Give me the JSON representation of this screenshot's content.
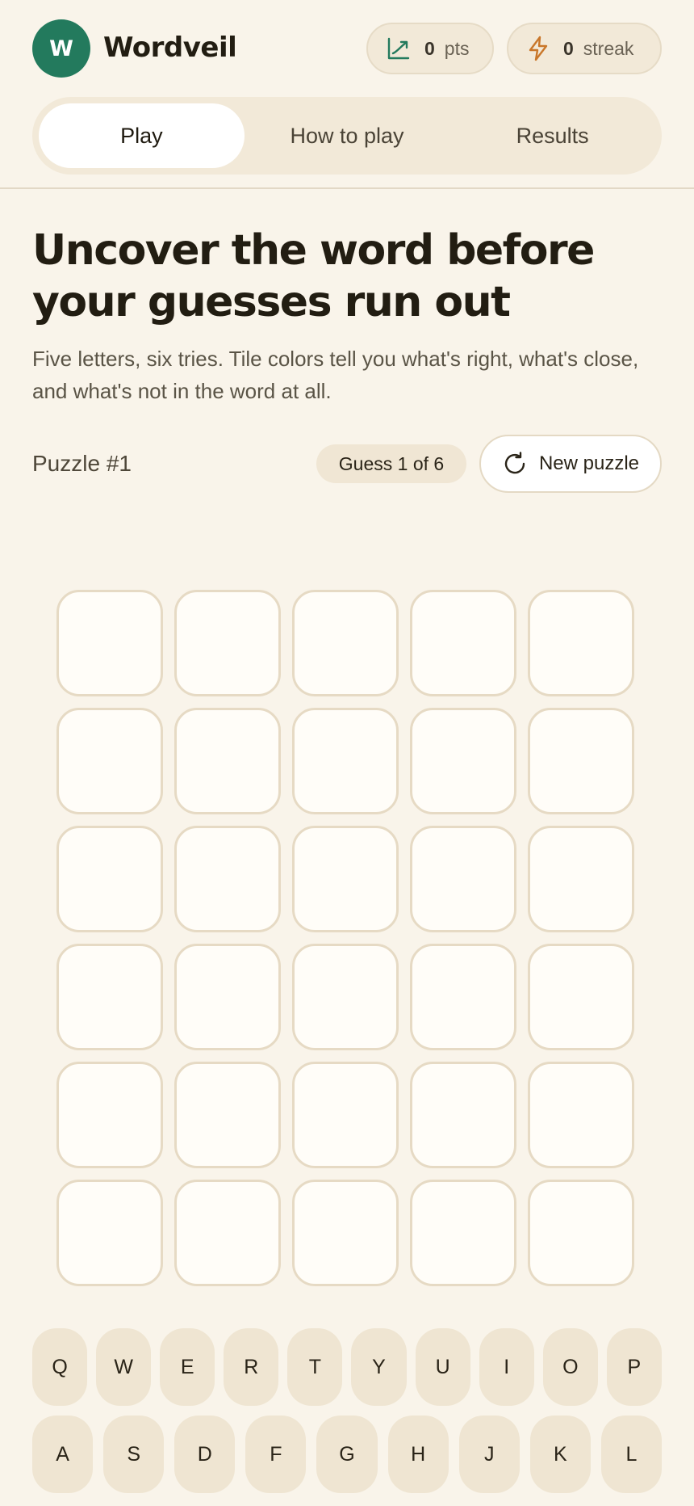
{
  "app": {
    "logo_letter": "W",
    "brand": "Wordveil"
  },
  "stats": {
    "points_value": "0",
    "points_label": "pts",
    "streak_value": "0",
    "streak_label": "streak"
  },
  "tabs": [
    {
      "label": "Play",
      "active": true
    },
    {
      "label": "How to play",
      "active": false
    },
    {
      "label": "Results",
      "active": false
    }
  ],
  "hero": {
    "title": "Uncover the word before your guesses run out",
    "subtitle": "Five letters, six tries. Tile colors tell you what's right, what's close, and what's not in the word at all."
  },
  "puzzle": {
    "label": "Puzzle #1",
    "guess_status": "Guess 1 of 6",
    "new_puzzle_label": "New puzzle"
  },
  "board": {
    "rows": 6,
    "cols": 5,
    "letters": [
      [
        "",
        "",
        "",
        "",
        ""
      ],
      [
        "",
        "",
        "",
        "",
        ""
      ],
      [
        "",
        "",
        "",
        "",
        ""
      ],
      [
        "",
        "",
        "",
        "",
        ""
      ],
      [
        "",
        "",
        "",
        "",
        ""
      ],
      [
        "",
        "",
        "",
        "",
        ""
      ]
    ]
  },
  "keyboard": {
    "row1": [
      "Q",
      "W",
      "E",
      "R",
      "T",
      "Y",
      "U",
      "I",
      "O",
      "P"
    ],
    "row2": [
      "A",
      "S",
      "D",
      "F",
      "G",
      "H",
      "J",
      "K",
      "L"
    ]
  },
  "colors": {
    "background": "#f9f4ea",
    "accent": "#237a5d",
    "streak_icon": "#c9772a",
    "tile_border": "#e6dac4",
    "key_bg": "#efe5d2"
  },
  "icons": {
    "points": "trend-up-icon",
    "streak": "lightning-icon",
    "new_puzzle": "refresh-icon"
  }
}
